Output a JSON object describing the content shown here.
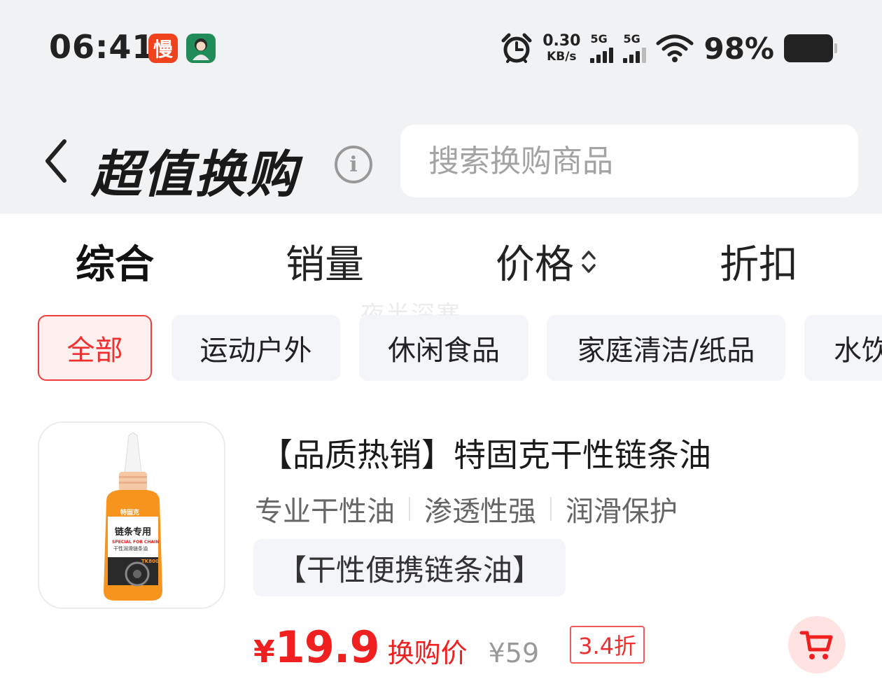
{
  "status_bar": {
    "time": "06:41",
    "app1_glyph": "慢",
    "net_speed_value": "0.30",
    "net_speed_unit": "KB/s",
    "sim1": "5G",
    "sim2": "5G",
    "battery": "98%",
    "icons": [
      "alarm-icon",
      "wifi-icon",
      "battery-icon",
      "signal-icon"
    ]
  },
  "header": {
    "title": "超值换购",
    "search_placeholder": "搜索换购商品"
  },
  "sort_tabs": [
    {
      "label": "综合",
      "active": true
    },
    {
      "label": "销量",
      "active": false
    },
    {
      "label": "价格",
      "active": false
    },
    {
      "label": "折扣",
      "active": false
    }
  ],
  "watermark": "夜半深寒",
  "categories": [
    {
      "label": "全部",
      "active": true
    },
    {
      "label": "运动户外",
      "active": false
    },
    {
      "label": "休闲食品",
      "active": false
    },
    {
      "label": "家庭清洁/纸品",
      "active": false
    },
    {
      "label": "水饮",
      "active": false
    }
  ],
  "product": {
    "title": "【品质热销】特固克干性链条油",
    "features": [
      "专业干性油",
      "渗透性强",
      "润滑保护"
    ],
    "tag": "【干性便携链条油】",
    "price_currency": "¥",
    "price": "19.9",
    "price_label": "换购价",
    "original_price": "¥59",
    "discount": "3.4折",
    "image": {
      "brand_text": "特固克",
      "label_text": "链条专用",
      "label_en": "SPECIAL FOR CHAIN",
      "label_sub": "干性润滑链条油",
      "model": "TK800"
    }
  },
  "colors": {
    "accent_red": "#f02020",
    "background_gray": "#f1f2f4",
    "chip_gray": "#f4f5f8"
  }
}
